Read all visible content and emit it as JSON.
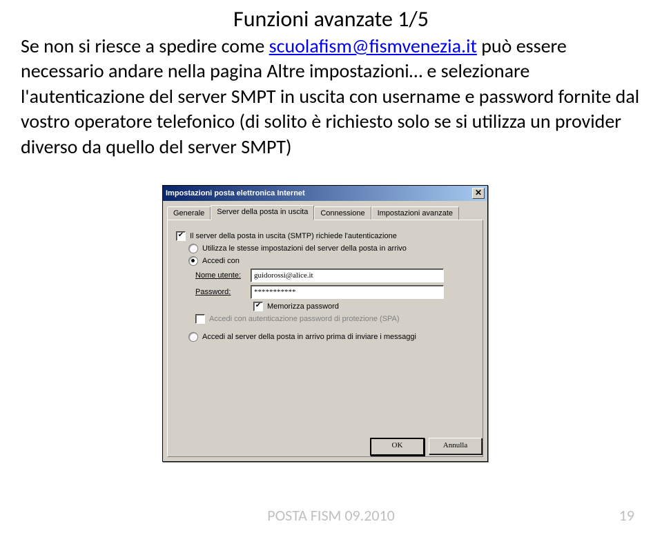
{
  "page": {
    "title": "Funzioni avanzate 1/5",
    "intro_pre": "Se non si riesce a spedire come ",
    "email": "scuolafism@fismvenezia.it",
    "intro_post": " può essere necessario andare nella pagina Altre impostazioni… e selezionare l'autenticazione del server SMPT in uscita con username e password fornite dal vostro operatore telefonico (di solito è richiesto solo se si utilizza un provider diverso da quello del server SMPT)"
  },
  "dialog": {
    "title": "Impostazioni posta elettronica Internet",
    "close": "✕",
    "tabs": [
      "Generale",
      "Server della posta in uscita",
      "Connessione",
      "Impostazioni avanzate"
    ],
    "smtp_auth_label": "Il server della posta in uscita (SMTP) richiede l'autenticazione",
    "same_settings_label": "Utilizza le stesse impostazioni del server della posta in arrivo",
    "login_with_label": "Accedi con",
    "username_label": "Nome utente:",
    "username_value": "guidorossi@alice.it",
    "password_label": "Password:",
    "password_value": "***********",
    "remember_label": "Memorizza password",
    "spa_label": "Accedi con autenticazione password di protezione (SPA)",
    "login_before_send_label": "Accedi al server della posta in arrivo prima di inviare i messaggi",
    "ok_label": "OK",
    "cancel_label": "Annulla"
  },
  "footer": {
    "text": "POSTA FISM 09.2010",
    "page": "19"
  }
}
